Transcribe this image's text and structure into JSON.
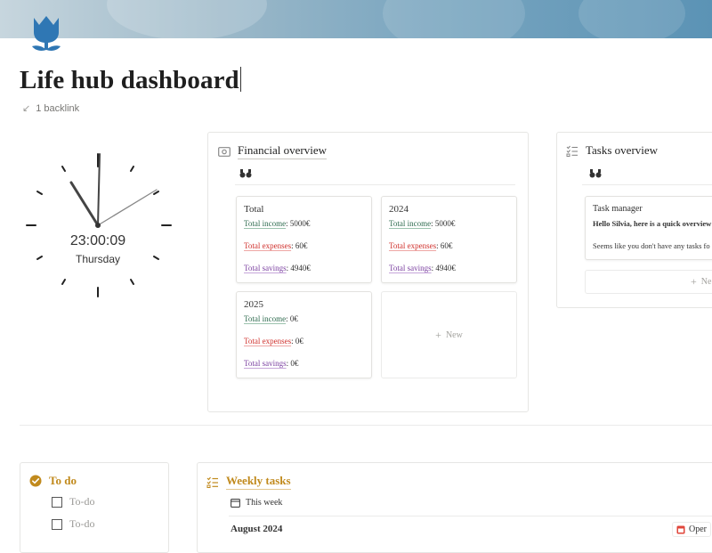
{
  "page": {
    "title": "Life hub dashboard",
    "backlink_text": "1 backlink",
    "icon": "tulip-icon"
  },
  "clock": {
    "time": "23:00:09",
    "day": "Thursday"
  },
  "financial_overview": {
    "title": "Financial overview",
    "icon": "money-icon",
    "view_icon": "binoculars-icon",
    "cards": [
      {
        "title": "Total",
        "income_label": "Total income",
        "income_value": ": 5000€",
        "expenses_label": "Total expenses",
        "expenses_value": ": 60€",
        "savings_label": "Total savings",
        "savings_value": ": 4940€"
      },
      {
        "title": "2024",
        "income_label": "Total income",
        "income_value": ": 5000€",
        "expenses_label": "Total expenses",
        "expenses_value": ": 60€",
        "savings_label": "Total savings",
        "savings_value": ": 4940€"
      },
      {
        "title": "2025",
        "income_label": "Total income",
        "income_value": ": 0€",
        "expenses_label": "Total expenses",
        "expenses_value": ": 0€",
        "savings_label": "Total savings",
        "savings_value": ": 0€"
      }
    ],
    "new_label": "New"
  },
  "tasks_overview": {
    "title": "Tasks overview",
    "icon": "checklist-icon",
    "view_icon": "binoculars-icon",
    "card_title": "Task manager",
    "greeting": "Hello Silvia, here is a quick overview",
    "note": "Seems like you don't have any tasks fo",
    "new_label": "Ne"
  },
  "todo": {
    "title": "To do",
    "icon": "check-circle-icon",
    "items": [
      "To-do",
      "To-do"
    ]
  },
  "weekly_tasks": {
    "title": "Weekly tasks",
    "icon": "checklist-icon",
    "view_label": "This week",
    "view_icon": "calendar-icon",
    "month_label": "August 2024",
    "open_label": "Oper",
    "open_icon": "calendar-red-icon"
  },
  "colors": {
    "accent": "#c18a1d",
    "income": "#2e6b4f",
    "expenses": "#d0312d",
    "savings": "#7a3fa0"
  }
}
